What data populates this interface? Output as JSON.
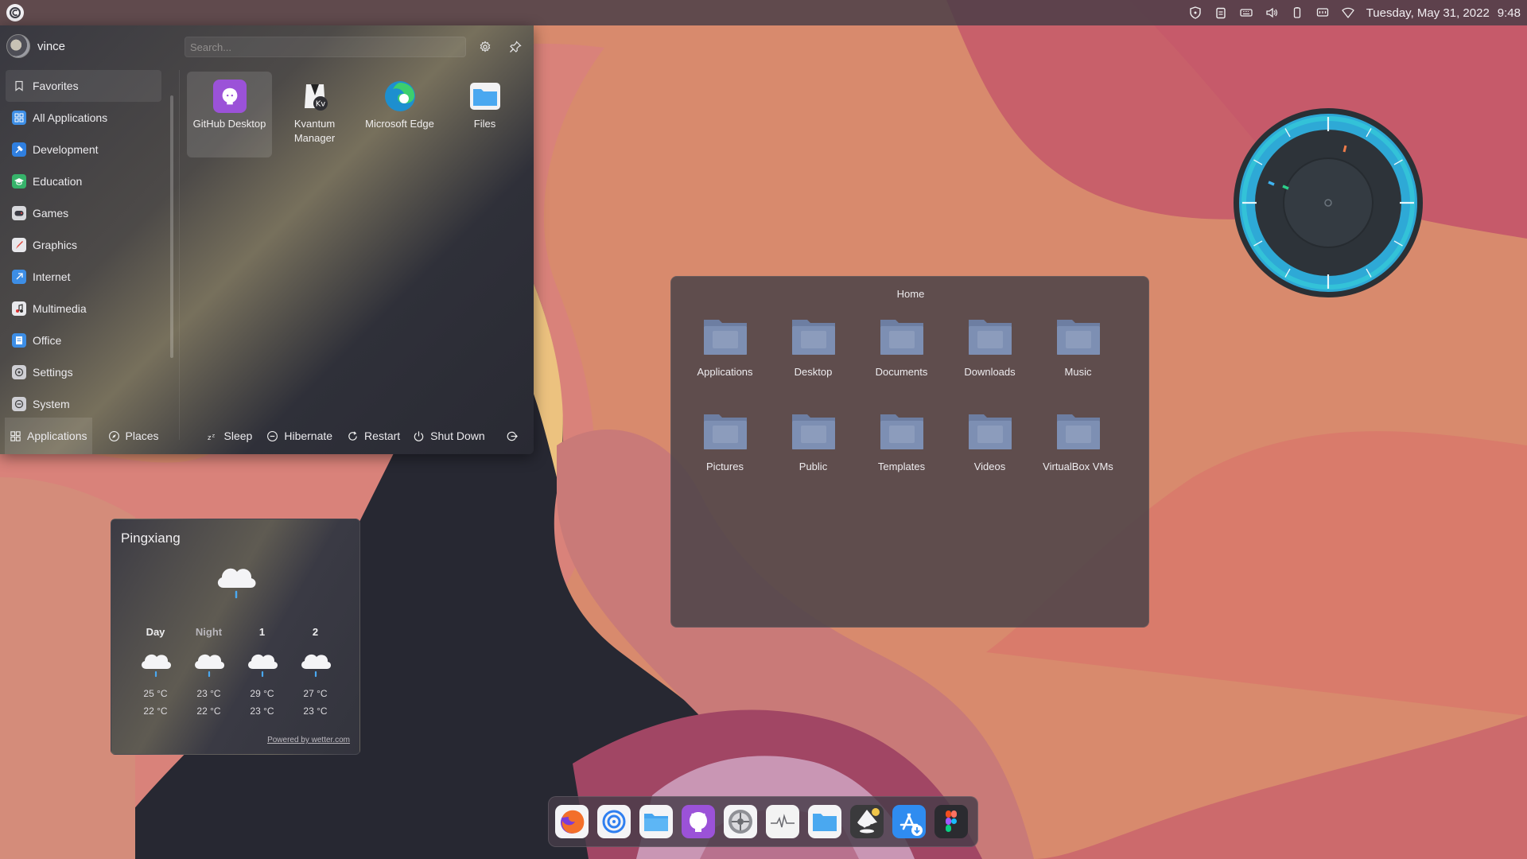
{
  "top_panel": {
    "launcher_icon": "kde-plasma-icon",
    "tray_icons": [
      "shield-icon",
      "clipboard-icon",
      "keyboard-icon",
      "volume-icon",
      "battery-icon",
      "display-icon",
      "network-icon"
    ],
    "date": "Tuesday, May 31, 2022",
    "time": "9:48"
  },
  "launcher": {
    "username": "vince",
    "search_placeholder": "Search...",
    "categories": [
      {
        "label": "Favorites",
        "icon": "bookmark-icon",
        "color": "transparent"
      },
      {
        "label": "All Applications",
        "icon": "grid-icon",
        "color": "#3d8ee6"
      },
      {
        "label": "Development",
        "icon": "hammer-icon",
        "color": "#2f7fe0"
      },
      {
        "label": "Education",
        "icon": "graduation-cap-icon",
        "color": "#36b36a"
      },
      {
        "label": "Games",
        "icon": "gamepad-icon",
        "color": "#d8d8dc"
      },
      {
        "label": "Graphics",
        "icon": "brush-icon",
        "color": "#e8e8ec"
      },
      {
        "label": "Internet",
        "icon": "globe-icon",
        "color": "#3d8ee6"
      },
      {
        "label": "Multimedia",
        "icon": "multimedia-icon",
        "color": "#e8e8ec"
      },
      {
        "label": "Office",
        "icon": "document-icon",
        "color": "#3d8ee6"
      },
      {
        "label": "Settings",
        "icon": "settings-icon",
        "color": "#cfcfd4"
      },
      {
        "label": "System",
        "icon": "system-icon",
        "color": "#cfcfd4"
      }
    ],
    "favorites": [
      {
        "label": "GitHub Desktop",
        "icon": "github-desktop-icon",
        "color": "#9b52d8"
      },
      {
        "label": "Kvantum Manager",
        "icon": "kvantum-icon",
        "color": "#f2f2f2"
      },
      {
        "label": "Microsoft Edge",
        "icon": "edge-icon",
        "color": "#1fa4d8"
      },
      {
        "label": "Files",
        "icon": "folder-icon",
        "color": "#4aa8f0"
      }
    ],
    "footer": {
      "applications": "Applications",
      "places": "Places",
      "sleep": "Sleep",
      "hibernate": "Hibernate",
      "restart": "Restart",
      "shutdown": "Shut Down"
    }
  },
  "folder_view": {
    "title": "Home",
    "items": [
      {
        "label": "Applications",
        "icon": "folder-applications-icon"
      },
      {
        "label": "Desktop",
        "icon": "folder-desktop-icon"
      },
      {
        "label": "Documents",
        "icon": "folder-documents-icon"
      },
      {
        "label": "Downloads",
        "icon": "folder-downloads-icon"
      },
      {
        "label": "Music",
        "icon": "folder-music-icon"
      },
      {
        "label": "Pictures",
        "icon": "folder-pictures-icon"
      },
      {
        "label": "Public",
        "icon": "folder-public-icon"
      },
      {
        "label": "Templates",
        "icon": "folder-templates-icon"
      },
      {
        "label": "Videos",
        "icon": "folder-videos-icon"
      },
      {
        "label": "VirtualBox VMs",
        "icon": "folder-icon"
      }
    ]
  },
  "weather": {
    "city": "Pingxiang",
    "current_icon": "rain-cloud-icon",
    "forecast": [
      {
        "label": "Day",
        "high": "25 °C",
        "low": "22 °C",
        "icon": "rain-cloud-icon"
      },
      {
        "label": "Night",
        "high": "23 °C",
        "low": "22 °C",
        "icon": "rain-cloud-icon"
      },
      {
        "label": "1",
        "high": "29 °C",
        "low": "23 °C",
        "icon": "rain-cloud-icon"
      },
      {
        "label": "2",
        "high": "27 °C",
        "low": "23 °C",
        "icon": "rain-cloud-icon"
      }
    ],
    "credit": "Powered by wetter.com"
  },
  "dock": {
    "items": [
      {
        "name": "firefox-icon",
        "color": "#f36f2a"
      },
      {
        "name": "browser-icon",
        "color": "#2f7ff0"
      },
      {
        "name": "files-icon",
        "color": "#46a5ef"
      },
      {
        "name": "github-desktop-icon",
        "color": "#9b52d8"
      },
      {
        "name": "system-settings-icon",
        "color": "#8f9096"
      },
      {
        "name": "system-monitor-icon",
        "color": "#f3f3f3"
      },
      {
        "name": "folder-icon",
        "color": "#4aa8f0"
      },
      {
        "name": "inkscape-icon",
        "color": "#3a3a3c"
      },
      {
        "name": "app-store-icon",
        "color": "#2f8cf0"
      },
      {
        "name": "figma-icon",
        "color": "#2b2b30"
      }
    ]
  },
  "colors": {
    "accent": "#3d8ee6",
    "folder": "#7d8fb3",
    "clock_ring": "#2ea9d6"
  }
}
